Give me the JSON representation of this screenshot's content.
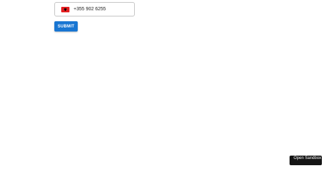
{
  "phone": {
    "country_flag": "albania-flag-icon",
    "value": "+355 902 6255"
  },
  "form": {
    "submit_label": "SUBMIT"
  },
  "sandbox": {
    "label": "Open Sandbox"
  },
  "colors": {
    "accent": "#1976d2",
    "flag_red": "#e41e20",
    "flag_eagle": "#000000",
    "sandbox_bg": "#151515"
  }
}
